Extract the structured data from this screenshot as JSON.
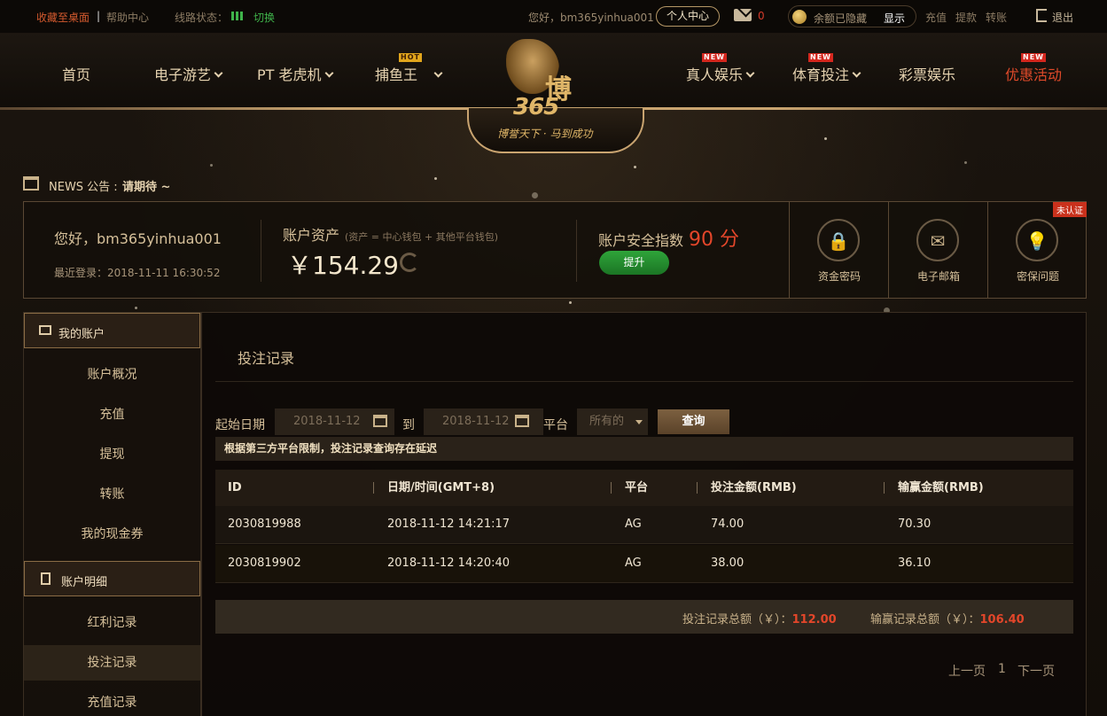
{
  "topbar": {
    "favorite": "收藏至桌面",
    "separator": "|",
    "help": "帮助中心",
    "line_status": "线路状态：",
    "switch": "切换",
    "greeting": "您好，bm365yinhua001",
    "personal_center": "个人中心",
    "message_count": "0",
    "balance_hidden": "余额已隐藏",
    "show": "显示",
    "recharge": "充值",
    "withdraw": "提款",
    "transfer": "转账",
    "logout": "退出"
  },
  "nav": {
    "home": "首页",
    "egames": "电子游艺",
    "pt_slots": "PT 老虎机",
    "fishing": "捕鱼王",
    "live": "真人娱乐",
    "sports": "体育投注",
    "lottery": "彩票娱乐",
    "promotions": "优惠活动",
    "badge_new": "NEW",
    "badge_hot": "HOT"
  },
  "logo": {
    "name_cn": "博",
    "name_num": "365",
    "slogan": "博誉天下 · 马到成功"
  },
  "news": {
    "label": "NEWS 公告 :",
    "text": "请期待 ~"
  },
  "account": {
    "hello": "您好，bm365yinhua001",
    "last_login": "最近登录：2018-11-11 16:30:52",
    "asset_label": "账户资产",
    "asset_note": "(资产 = 中心钱包 + 其他平台钱包)",
    "asset_value": "￥154.29",
    "security_label": "账户安全指数",
    "security_score": "90 分",
    "upgrade": "提升",
    "fund_password": "资金密码",
    "email": "电子邮箱",
    "security_question": "密保问题",
    "unverified": "未认证"
  },
  "sidebar": {
    "my_account": "我的账户",
    "items1": [
      "账户概况",
      "充值",
      "提现",
      "转账",
      "我的现金券"
    ],
    "account_details": "账户明细",
    "items2": [
      "红利记录",
      "投注记录",
      "充值记录"
    ]
  },
  "content": {
    "title": "投注记录",
    "start_date_label": "起始日期",
    "start_date": "2018-11-12",
    "to_label": "到",
    "end_date": "2018-11-12",
    "platform_label": "平台",
    "platform_value": "所有的",
    "query": "查询",
    "notice": "根据第三方平台限制，投注记录查询存在延迟",
    "headers": [
      "ID",
      "日期/时间(GMT+8)",
      "平台",
      "投注金额(RMB)",
      "输赢金额(RMB)"
    ],
    "rows": [
      {
        "id": "2030819988",
        "datetime": "2018-11-12 14:21:17",
        "platform": "AG",
        "bet": "74.00",
        "winloss": "70.30"
      },
      {
        "id": "2030819902",
        "datetime": "2018-11-12 14:20:40",
        "platform": "AG",
        "bet": "38.00",
        "winloss": "36.10"
      }
    ],
    "bet_total_label": "投注记录总额（￥）：",
    "bet_total": "112.00",
    "winloss_total_label": "输赢记录总额（￥）：",
    "winloss_total": "106.40",
    "prev": "上一页",
    "page": "1",
    "next": "下一页"
  },
  "colors": {
    "accent_gold": "#c9a470",
    "alert_red": "#e3462a",
    "success_green": "#2fa43a"
  }
}
